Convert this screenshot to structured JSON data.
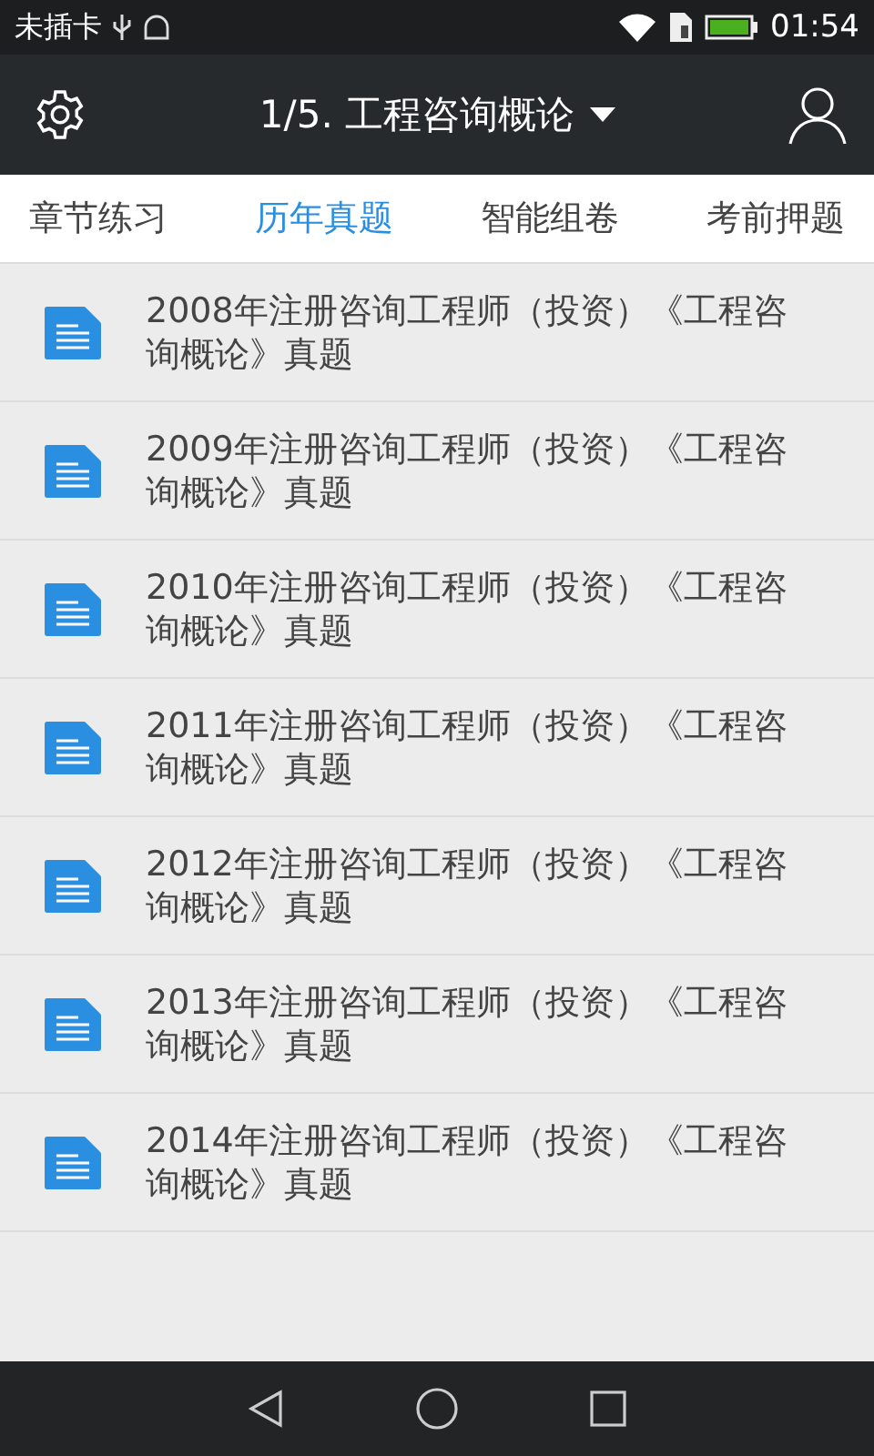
{
  "status_bar": {
    "carrier": "未插卡",
    "time": "01:54"
  },
  "app_bar": {
    "title": "1/5. 工程咨询概论"
  },
  "tabs": [
    {
      "label": "章节练习",
      "selected": false
    },
    {
      "label": "历年真题",
      "selected": true
    },
    {
      "label": "智能组卷",
      "selected": false
    },
    {
      "label": "考前押题",
      "selected": false
    }
  ],
  "papers": [
    {
      "title": "2008年注册咨询工程师（投资）《工程咨询概论》真题"
    },
    {
      "title": "2009年注册咨询工程师（投资）《工程咨询概论》真题"
    },
    {
      "title": "2010年注册咨询工程师（投资）《工程咨询概论》真题"
    },
    {
      "title": "2011年注册咨询工程师（投资）《工程咨询概论》真题"
    },
    {
      "title": "2012年注册咨询工程师（投资）《工程咨询概论》真题"
    },
    {
      "title": "2013年注册咨询工程师（投资）《工程咨询概论》真题"
    },
    {
      "title": "2014年注册咨询工程师（投资）《工程咨询概论》真题"
    }
  ]
}
